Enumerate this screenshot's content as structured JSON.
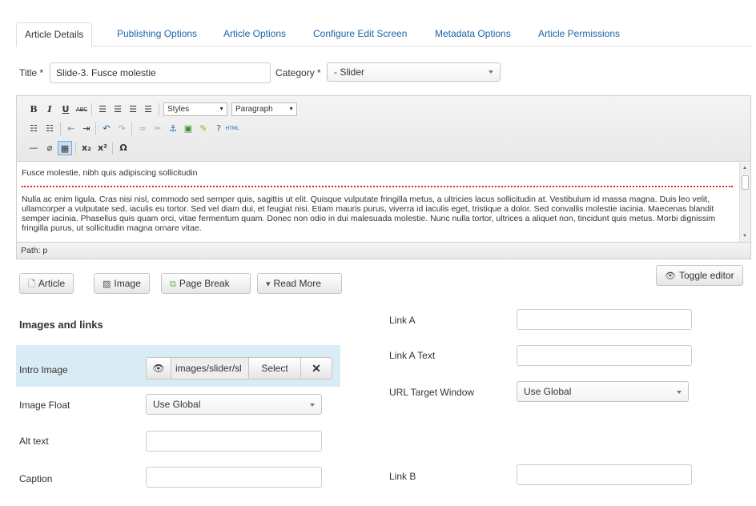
{
  "tabs": [
    {
      "label": "Article Details",
      "active": true
    },
    {
      "label": "Publishing Options"
    },
    {
      "label": "Article Options"
    },
    {
      "label": "Configure Edit Screen"
    },
    {
      "label": "Metadata Options"
    },
    {
      "label": "Article Permissions"
    }
  ],
  "title": {
    "label": "Title *",
    "value": "Slide-3. Fusce molestie"
  },
  "category": {
    "label": "Category *",
    "value": "- Slider"
  },
  "editor": {
    "styles_select": "Styles",
    "format_select": "Paragraph",
    "first_line": "Fusce molestie, nibh quis adipiscing sollicitudin",
    "body_text": "Nulla ac enim ligula. Cras nisi nisl, commodo sed semper quis, sagittis ut elit. Quisque vulputate fringilla metus, a ultricies lacus sollicitudin at. Vestibulum id massa magna. Duis leo velit, ullamcorper a vulputate sed, iaculis eu tortor. Sed vel diam dui, et feugiat nisi. Etiam mauris purus, viverra id iaculis eget, tristique a dolor. Sed convallis molestie iacinia. Maecenas blandit semper iacinia. Phasellus quis quam orci, vitae fermentum quam. Donec non odio in dui malesuada molestie. Nunc nulla tortor, ultrices a aliquet non, tincidunt quis metus. Morbi dignissim fringilla purus, ut sollicitudin magna ornare vitae.",
    "path": "Path: p"
  },
  "buttons": {
    "article": "Article",
    "image": "Image",
    "page_break": "Page Break",
    "read_more": "Read More",
    "toggle_editor": "Toggle editor"
  },
  "images_links": {
    "heading": "Images and links",
    "intro_image": {
      "label": "Intro Image",
      "value": "images/slider/sl",
      "select": "Select"
    },
    "image_float": {
      "label": "Image Float",
      "value": "Use Global"
    },
    "alt_text": {
      "label": "Alt text",
      "value": ""
    },
    "caption": {
      "label": "Caption",
      "value": ""
    },
    "link_a": {
      "label": "Link A",
      "value": ""
    },
    "link_a_text": {
      "label": "Link A Text",
      "value": ""
    },
    "url_target": {
      "label": "URL Target Window",
      "value": "Use Global"
    },
    "link_b": {
      "label": "Link B",
      "value": ""
    }
  },
  "icons": [
    "eye-icon",
    "close-icon",
    "article-icon",
    "image-icon",
    "page-break-icon",
    "chevron-down-icon"
  ],
  "colors": {
    "link": "#1a65a8",
    "highlight_row": "#d9ebf5",
    "page_break_line": "#e02020"
  }
}
